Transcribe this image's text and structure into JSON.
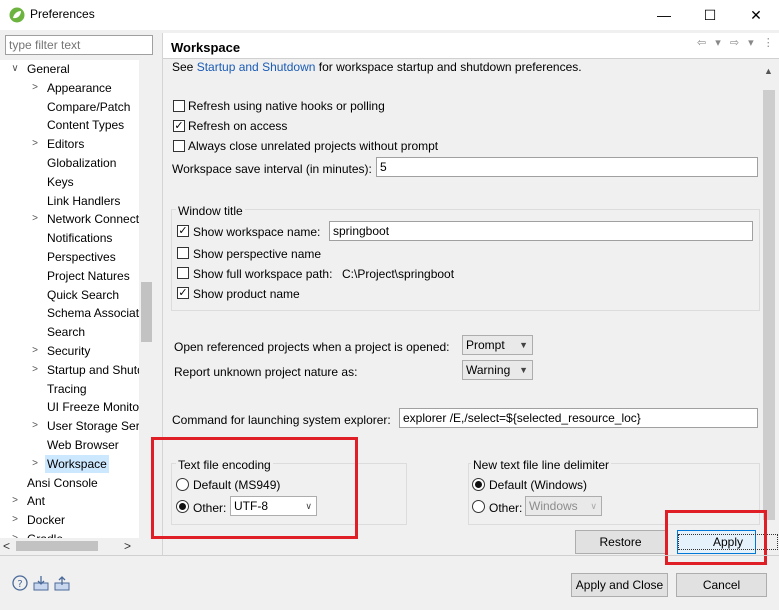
{
  "window": {
    "title": "Preferences",
    "controls": {
      "minimize": "—",
      "maximize": "☐",
      "close": "✕"
    }
  },
  "filter": {
    "placeholder": "type filter text"
  },
  "tree": {
    "items": [
      {
        "label": "General",
        "level": 0,
        "expander": "open"
      },
      {
        "label": "Appearance",
        "level": 1,
        "expander": "closed"
      },
      {
        "label": "Compare/Patch",
        "level": 1,
        "expander": "none"
      },
      {
        "label": "Content Types",
        "level": 1,
        "expander": "none"
      },
      {
        "label": "Editors",
        "level": 1,
        "expander": "closed"
      },
      {
        "label": "Globalization",
        "level": 1,
        "expander": "none"
      },
      {
        "label": "Keys",
        "level": 1,
        "expander": "none"
      },
      {
        "label": "Link Handlers",
        "level": 1,
        "expander": "none"
      },
      {
        "label": "Network Connecti",
        "level": 1,
        "expander": "closed"
      },
      {
        "label": "Notifications",
        "level": 1,
        "expander": "none"
      },
      {
        "label": "Perspectives",
        "level": 1,
        "expander": "none"
      },
      {
        "label": "Project Natures",
        "level": 1,
        "expander": "none"
      },
      {
        "label": "Quick Search",
        "level": 1,
        "expander": "none"
      },
      {
        "label": "Schema Associati",
        "level": 1,
        "expander": "none"
      },
      {
        "label": "Search",
        "level": 1,
        "expander": "none"
      },
      {
        "label": "Security",
        "level": 1,
        "expander": "closed"
      },
      {
        "label": "Startup and Shutd",
        "level": 1,
        "expander": "closed"
      },
      {
        "label": "Tracing",
        "level": 1,
        "expander": "none"
      },
      {
        "label": "UI Freeze Monitor",
        "level": 1,
        "expander": "none"
      },
      {
        "label": "User Storage Serv",
        "level": 1,
        "expander": "closed"
      },
      {
        "label": "Web Browser",
        "level": 1,
        "expander": "none"
      },
      {
        "label": "Workspace",
        "level": 1,
        "expander": "closed",
        "selected": true
      },
      {
        "label": "Ansi Console",
        "level": 0,
        "expander": "none"
      },
      {
        "label": "Ant",
        "level": 0,
        "expander": "closed"
      },
      {
        "label": "Docker",
        "level": 0,
        "expander": "closed"
      },
      {
        "label": "Gradle",
        "level": 0,
        "expander": "closed"
      }
    ],
    "hscroll_left": "<",
    "hscroll_right": ">"
  },
  "page": {
    "title": "Workspace",
    "nav_icons": "⇦ ▾ ⇨ ▾ ⋮",
    "intro_prefix": "See ",
    "intro_link": "Startup and Shutdown",
    "intro_suffix": " for workspace startup and shutdown preferences.",
    "refresh_native": {
      "label": "Refresh using native hooks or polling",
      "checked": false
    },
    "refresh_access": {
      "label": "Refresh on access",
      "checked": true
    },
    "always_close": {
      "label": "Always close unrelated projects without prompt",
      "checked": false
    },
    "save_interval": {
      "label": "Workspace save interval (in minutes):",
      "value": "5"
    },
    "window_title": {
      "group_label": "Window title",
      "show_workspace_name": {
        "label": "Show workspace name:",
        "checked": true,
        "value": "springboot"
      },
      "show_perspective_name": {
        "label": "Show perspective name",
        "checked": false
      },
      "show_full_path": {
        "label": "Show full workspace path:",
        "checked": false,
        "value": "C:\\Project\\springboot"
      },
      "show_product_name": {
        "label": "Show product name",
        "checked": true
      }
    },
    "open_referenced": {
      "label": "Open referenced projects when a project is opened:",
      "value": "Prompt"
    },
    "report_unknown": {
      "label": "Report unknown project nature as:",
      "value": "Warning"
    },
    "explorer_command": {
      "label": "Command for launching system explorer:",
      "value": "explorer /E,/select=${selected_resource_loc}"
    },
    "text_encoding": {
      "group_label": "Text file encoding",
      "default_label": "Default (MS949)",
      "other_label": "Other:",
      "other_value": "UTF-8",
      "selected": "other"
    },
    "line_delimiter": {
      "group_label": "New text file line delimiter",
      "default_label": "Default (Windows)",
      "other_label": "Other:",
      "other_value": "Windows",
      "selected": "default"
    },
    "restore_defaults": "Restore Defaults",
    "apply": "Apply"
  },
  "footer": {
    "apply_close": "Apply and Close",
    "cancel": "Cancel"
  },
  "colors": {
    "highlight": "#e01e26",
    "link": "#1a5bb5",
    "selection": "#cce8ff"
  }
}
